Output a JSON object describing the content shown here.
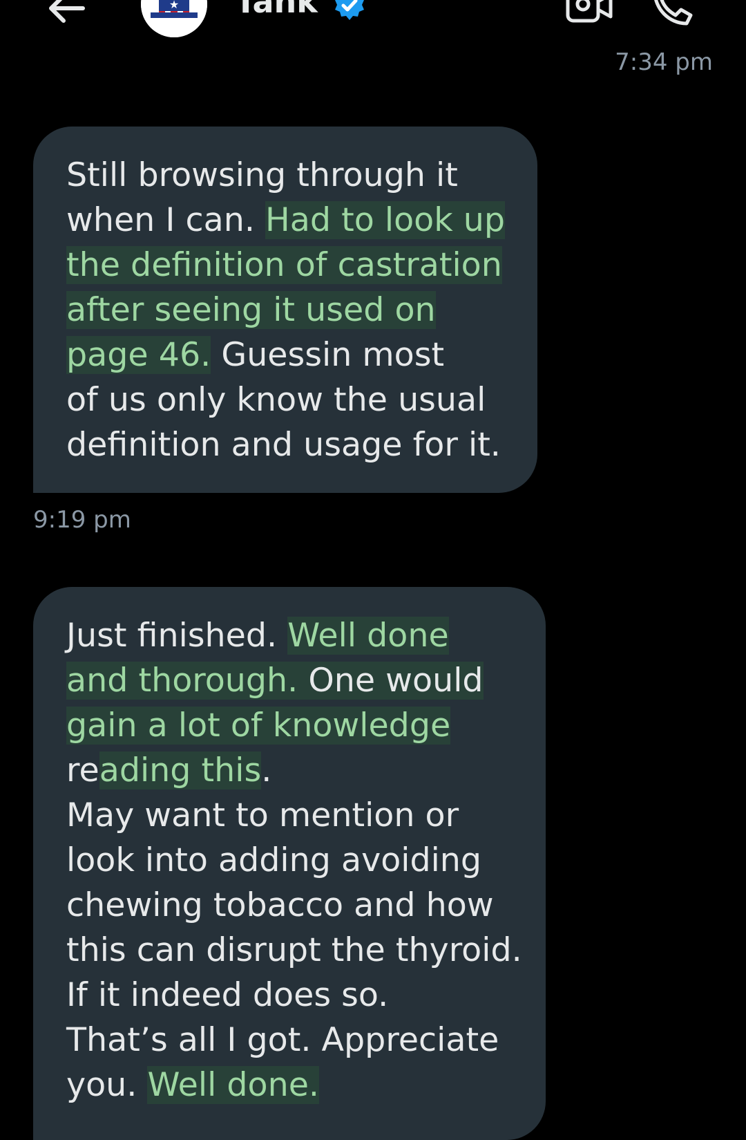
{
  "header": {
    "contact_name": "Tank",
    "back_icon": "arrow-left-icon",
    "avatar_icon": "uncle-sam-hat-avatar",
    "verified_icon": "verified-badge-icon",
    "video_icon": "video-camera-icon",
    "call_icon": "phone-icon"
  },
  "conversation": {
    "prev_timestamp": "7:34 pm",
    "messages": [
      {
        "time": "9:19 pm",
        "lines": [
          {
            "a": "Still browsing through it"
          },
          {
            "a": "when I can.  ",
            "b": "Had to look up"
          },
          {
            "b": "the definition of castration"
          },
          {
            "b": "after seeing it used on"
          },
          {
            "b": "page 46.",
            "c": "  Guessin most"
          },
          {
            "a": "of us only know the usual"
          },
          {
            "a": "definition and usage for it."
          }
        ]
      },
      {
        "lines": [
          {
            "a": "Just finished.  ",
            "b": "Well done"
          },
          {
            "b": "and thorough.",
            "c": "  One would"
          },
          {
            "b": "gain a lot of knowledge"
          },
          {
            "a": "re",
            "b": "ading this",
            "c": "."
          },
          {
            "a": "May want to mention or"
          },
          {
            "a": "look into adding avoiding"
          },
          {
            "a": "chewing tobacco and how"
          },
          {
            "a": "this can disrupt the thyroid."
          },
          {
            "a": "If it indeed does so."
          },
          {
            "a": "That’s all I got.  Appreciate"
          },
          {
            "a": "you.  ",
            "b": "Well done."
          }
        ]
      }
    ]
  },
  "colors": {
    "background": "#000000",
    "bubble": "#263139",
    "text": "#e7e9ea",
    "highlight_text": "#9ed7a2",
    "muted": "#8b98a5",
    "verified": "#1d9bf0"
  }
}
